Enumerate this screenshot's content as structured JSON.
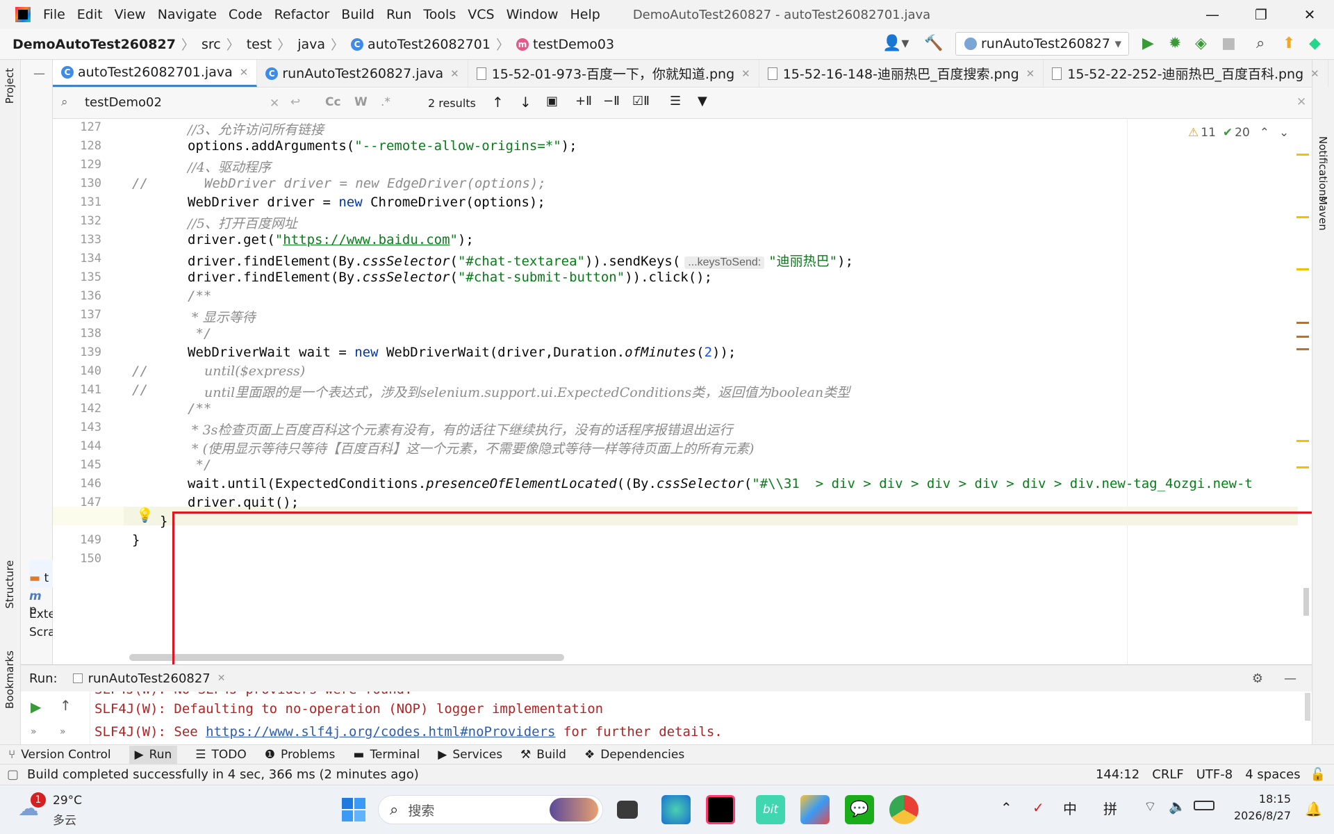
{
  "window": {
    "title": "DemoAutoTest260827 - autoTest26082701.java",
    "menu": [
      "File",
      "Edit",
      "View",
      "Navigate",
      "Code",
      "Refactor",
      "Build",
      "Run",
      "Tools",
      "VCS",
      "Window",
      "Help"
    ]
  },
  "nav": {
    "project": "DemoAutoTest260827",
    "path": [
      "src",
      "test",
      "java"
    ],
    "class": "autoTest26082701",
    "method": "testDemo03",
    "run_config": "runAutoTest260827"
  },
  "tabs": [
    {
      "label": "autoTest26082701.java",
      "active": true
    },
    {
      "label": "runAutoTest260827.java"
    },
    {
      "label": "15-52-01-973-百度一下，你就知道.png"
    },
    {
      "label": "15-52-16-148-迪丽热巴_百度搜索.png"
    },
    {
      "label": "15-52-22-252-迪丽热巴_百度百科.png"
    }
  ],
  "find": {
    "query": "testDemo02",
    "results": "2 results",
    "cc": "Cc",
    "w": "W"
  },
  "inspections": {
    "warnings": "11",
    "ok": "20"
  },
  "editor": {
    "line_numbers": [
      "127",
      "128",
      "129",
      "130",
      "131",
      "132",
      "133",
      "134",
      "135",
      "136",
      "137",
      "138",
      "139",
      "140",
      "141",
      "142",
      "143",
      "144",
      "145",
      "146",
      "147",
      "148",
      "149",
      "150"
    ],
    "l127": "//3、允许访问所有链接",
    "l128a": "options.addArguments(",
    "l128b": "\"--remote-allow-origins=*\"",
    "l128c": ");",
    "l129": "//4、驱动程序",
    "l130a": "//",
    "l130b": "WebDriver driver = new EdgeDriver(options);",
    "l131a": "WebDriver driver = ",
    "l131b": "new ",
    "l131c": "ChromeDriver(options);",
    "l132": "//5、打开百度网址",
    "l133a": "driver.get(",
    "l133b": "\"",
    "l133c": "https://www.baidu.com",
    "l133d": "\"",
    "l133e": ");",
    "l134a": "driver.findElement(By.",
    "l134b": "cssSelector",
    "l134c": "(",
    "l134d": "\"#chat-textarea\"",
    "l134e": ")).sendKeys(",
    "l134hint": "...keysToSend:",
    "l134f": "\"迪丽热巴\"",
    "l134g": ");",
    "l135a": "driver.findElement(By.",
    "l135b": "cssSelector",
    "l135c": "(",
    "l135d": "\"#chat-submit-button\"",
    "l135e": ")).click();",
    "l136": "/**",
    "l137": " * 显示等待",
    "l138": " */",
    "l139a": "WebDriverWait wait = ",
    "l139b": "new ",
    "l139c": "WebDriverWait(driver,Duration.",
    "l139d": "ofMinutes",
    "l139e": "(",
    "l139f": "2",
    "l139g": "));",
    "l140a": "//",
    "l140b": "until($express)",
    "l141a": "//",
    "l141b": "until里面跟的是一个表达式，涉及到selenium.support.ui.ExpectedConditions类，返回值为boolean类型",
    "l142": "/**",
    "l143": " * 3s检查页面上百度百科这个元素有没有，有的话往下继续执行，没有的话程序报错退出运行",
    "l144": " * (使用显示等待只等待【百度百科】这一个元素，不需要像隐式等待一样等待页面上的所有元素)",
    "l145": " */",
    "l146a": "wait.until(ExpectedConditions.",
    "l146b": "presenceOfElementLocated",
    "l146c": "((By.",
    "l146d": "cssSelector",
    "l146e": "(",
    "l146f": "\"#\\\\31  > div > div > div > div > div > div.new-tag_4ozgi.new-t",
    "l147": "driver.quit();",
    "l148": "}",
    "l149": "}"
  },
  "run": {
    "label": "Run:",
    "tab": "runAutoTest260827",
    "lines": [
      "SLF4J(W): No SLF4J providers were found.",
      "SLF4J(W): Defaulting to no-operation (NOP) logger implementation",
      "SLF4J(W): See ",
      "https://www.slf4j.org/codes.html#noProviders",
      " for further details."
    ]
  },
  "tooltabs": [
    "Version Control",
    "Run",
    "TODO",
    "Problems",
    "Terminal",
    "Services",
    "Build",
    "Dependencies"
  ],
  "status": {
    "message": "Build completed successfully in 4 sec, 366 ms (2 minutes ago)",
    "position": "144:12",
    "line_sep": "CRLF",
    "encoding": "UTF-8",
    "indent": "4 spaces"
  },
  "side": {
    "project": "Project",
    "structure": "Structure",
    "bookmarks": "Bookmarks",
    "notifications": "Notifications",
    "maven": "Maven",
    "tree_items": [
      "t",
      "p",
      "Exte",
      "Scra"
    ]
  },
  "taskbar": {
    "temp": "29°C",
    "weather": "多云",
    "badge": "1",
    "search": "搜索",
    "ime1": "中",
    "ime2": "拼",
    "time": "18:15",
    "date": "2026/8/27"
  }
}
